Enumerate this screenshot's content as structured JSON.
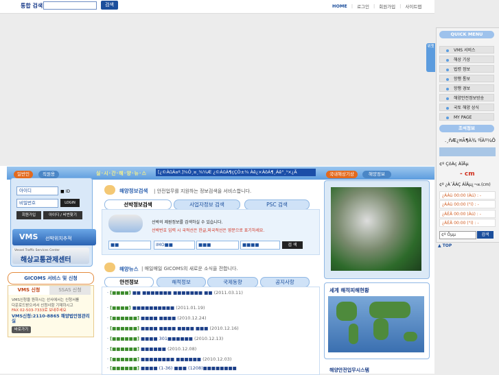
{
  "header": {
    "search_label": "통합 검색",
    "search_button": "검색",
    "nav": [
      "HOME",
      "로그인",
      "회원가입",
      "사이트맵"
    ]
  },
  "banner": {
    "slogan": "실·시·간·해·양·뉴·스",
    "ticker": "[¿©ÀûÀ¤º.]¾Ö¸¤¸¾¼Æ ¿©ÀûÀ¶çÇÒ±¾ Àê¿×ÀöÀ¶¸Áê°¸¹×¿Ã"
  },
  "login": {
    "tab_general": "일반인",
    "tab_staff": "직원용",
    "id_placeholder": "아이디",
    "pw_placeholder": "비밀번호",
    "save_id": "ID",
    "login_button": "LOGIN",
    "signup_button": "회원가입",
    "find_button": "아이디 / 비번찾기"
  },
  "vms_banner": {
    "title": "VMS",
    "subtitle": "선박위치추적",
    "vtc_small": "Vessel Traffic Services Center",
    "vtc_title": "해상교통관제센터"
  },
  "gicoms": {
    "heading": "GICOMS 서비스 및 신청",
    "tab_vms": "VMS 신청",
    "tab_ssas": "SSAS 신청",
    "text1": "VMS신청을 원하시는 선사에서는 신청서를",
    "text2": "다운로드받으셔서 신청사항 기재하시고",
    "fax": "FAX 02-503-7333로 보내주세요",
    "tel": "VMS신청:2110-8865 해양법안정관리실",
    "download": "바로가기"
  },
  "ship_search": {
    "title": "해양정보검색",
    "desc": "| 안전업무를 지원하는 정보검색을 서비스합니다.",
    "tabs": [
      "선박정보검색",
      "사업자정보 검색",
      "PSC 검색"
    ],
    "desc1": "선박의 제원정보를 검색하실 수 있습니다.",
    "desc2": "선박번호 입력 시 국적선은 한글,외국적선은 영문으로 표기하세요.",
    "fields": [
      "■■",
      "IMO■■",
      "■■■",
      "■■■■"
    ],
    "button": "검 색"
  },
  "news": {
    "title": "해양뉴스",
    "desc": "| 매일매일 GICOMS의 새로운 소식을 전합니다.",
    "tabs": [
      "안전정보",
      "해적정보",
      "국제동향",
      "공지사항"
    ],
    "items": [
      {
        "cat": "[■■■■]",
        "title": "■■ ■■■■■■■ ■■■■■■■ ■■",
        "date": "(2011.03.11)"
      },
      {
        "cat": "[■■■■]",
        "title": "■■■■■■■■■■",
        "date": "(2011.01.19)"
      },
      {
        "cat": "[■■■■■■]",
        "title": "■■■■ ■■■■",
        "date": "(2010.12.24)"
      },
      {
        "cat": "[■■■■■■]",
        "title": "■■■■ ■■■■ ■■■■ ■■■",
        "date": "(2010.12.16)"
      },
      {
        "cat": "[■■■■■■]",
        "title": "■■■■ 301■■■■■■",
        "date": "(2010.12.13)"
      },
      {
        "cat": "[■■■■■■]",
        "title": "■■■■■■",
        "date": "(2010.12.08)"
      },
      {
        "cat": "[■■■■■■]",
        "title": "■■■■■■■■ ■■■■■■",
        "date": "(2010.12.03)"
      },
      {
        "cat": "[■■■■■■]",
        "title": "■■■■ (1-36) ■■■ (1208)■■■■■■■■",
        "date": ""
      }
    ]
  },
  "weather": {
    "tab1": "국내해상기상",
    "tab2": "해양정보",
    "world_title": "세계 해적피해현황",
    "safety_title": "해양안전업무시스템"
  },
  "quick_menu": {
    "title": "QUICK MENU",
    "side_tab": "위젯",
    "items": [
      "VMS 서비스",
      "해상 기상",
      "법령 정보",
      "항행 통보",
      "항행 경보",
      "해양안전정보방송",
      "국토 해양 상식",
      "MY PAGE"
    ],
    "tide_title": "조석정보",
    "tide_date": ".¸ñÆ¿¤Ã¶À¾ ºÏÀº¼Ö",
    "tide_loc": "¢º ÇöÀç ÀÎÃµ",
    "tide_cm": "- cm",
    "tide_label": "¢º ¿À´ÃÀÇ ÀÎÃµ¿¬¤.(cm)",
    "tide_rows": [
      "¿ÀÀü 00:00 (Àú) : -",
      "¿ÀÀü 00:00 (°í) : -",
      "¿ÀÈÄ 00:00 (Àú) : -",
      "¿ÀÈÄ 00:00 (°í) : -"
    ],
    "tide_select": "¢º Ôµµ",
    "tide_button": "검색",
    "top": "TOP"
  },
  "colors": {
    "brand_blue": "#1c4f9c",
    "accent_orange": "#e36a1e",
    "band_blue": "#5c9cde"
  }
}
